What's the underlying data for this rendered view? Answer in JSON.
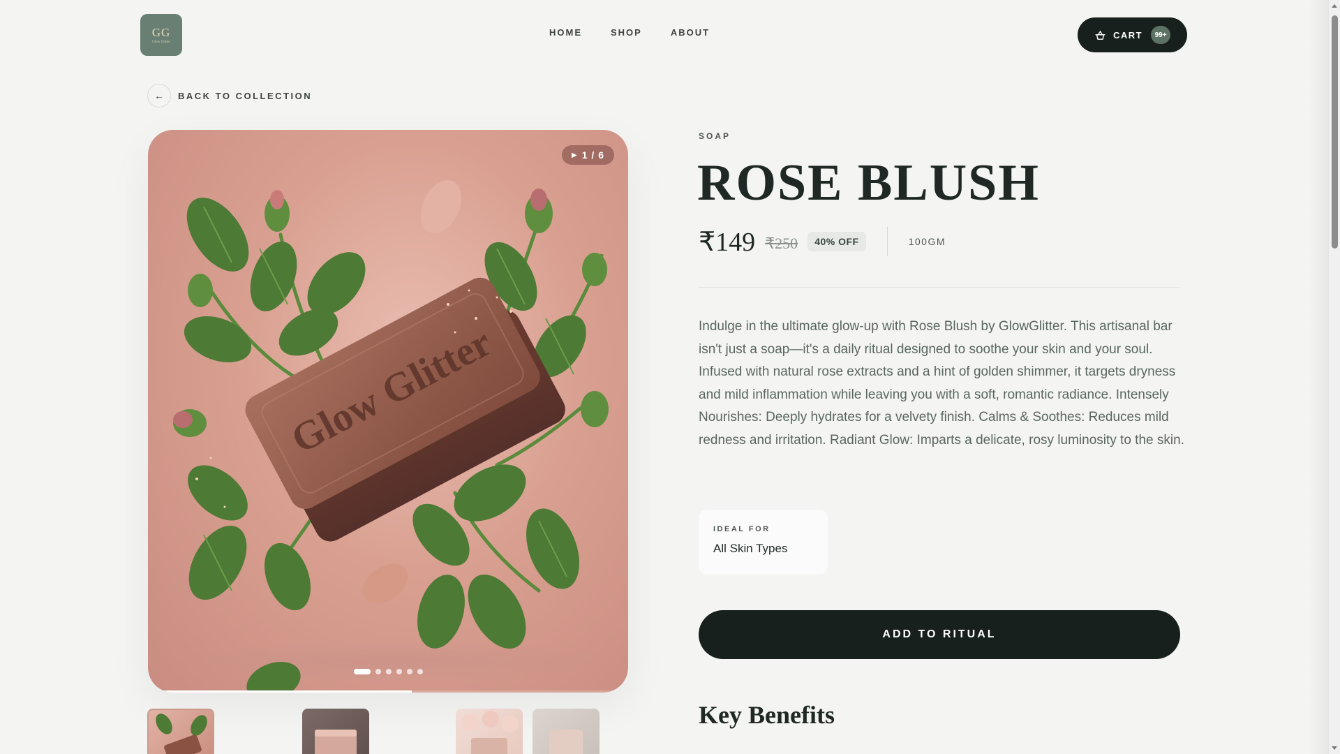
{
  "header": {
    "logo": {
      "monogram": "GG",
      "tagline": "Glow Glitter"
    },
    "nav": [
      {
        "label": "HOME"
      },
      {
        "label": "SHOP"
      },
      {
        "label": "ABOUT"
      }
    ],
    "cart": {
      "label": "CART",
      "count": "99+",
      "icon": "basket-icon"
    }
  },
  "back": {
    "label": "BACK TO COLLECTION",
    "icon": "arrow-left-icon"
  },
  "gallery": {
    "counter": "1 / 6",
    "play_icon": "play-icon",
    "slides_total": 6,
    "active_slide": 1,
    "progress": 0.55,
    "bar_text": "Glow Glitter"
  },
  "product": {
    "category": "SOAP",
    "title": "ROSE BLUSH",
    "price": "₹149",
    "mrp": "₹250",
    "discount": "40% OFF",
    "weight": "100GM",
    "description": "Indulge in the ultimate glow-up with Rose Blush by GlowGlitter. This artisanal bar isn't just a soap—it's a daily ritual designed to soothe your skin and your soul. Infused with natural rose extracts and a hint of golden shimmer, it targets dryness and mild inflammation while leaving you with a soft, romantic radiance. Intensely Nourishes: Deeply hydrates for a velvety finish. Calms & Soothes: Reduces mild redness and irritation. Radiant Glow: Imparts a delicate, rosy luminosity to the skin.",
    "ideal_for_label": "IDEAL FOR",
    "ideal_for_value": "All Skin Types",
    "cta": "ADD TO RITUAL",
    "benefits_heading": "Key Benefits"
  },
  "colors": {
    "background": "#f4f5f3",
    "dark": "#17201c",
    "sage": "#6a7f73",
    "rose": "#d9a091"
  }
}
